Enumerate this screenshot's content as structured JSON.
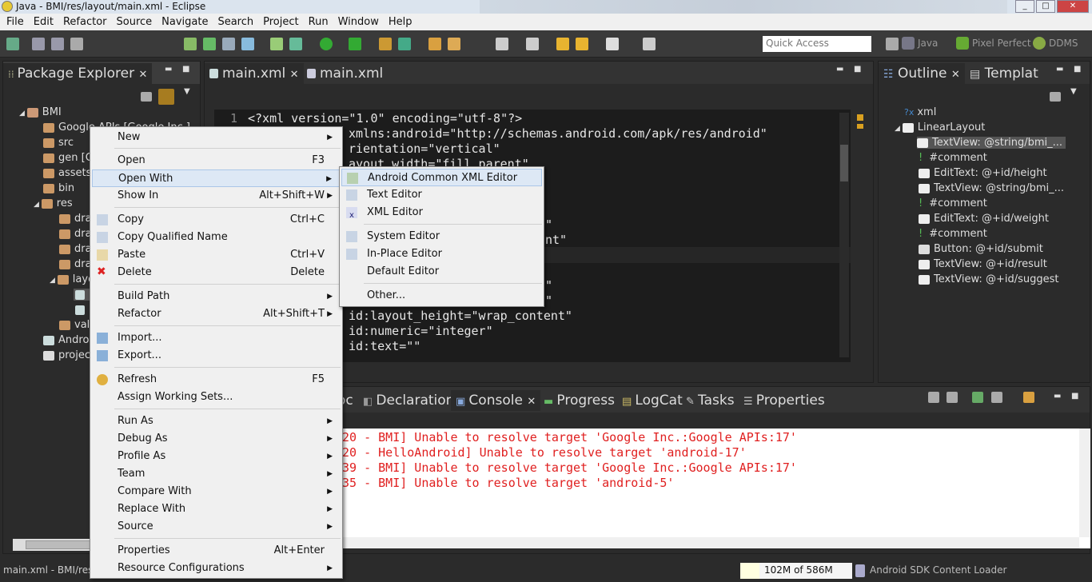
{
  "window": {
    "title": "Java - BMI/res/layout/main.xml - Eclipse",
    "min": "_",
    "max": "□",
    "close": "✕"
  },
  "menubar": [
    "File",
    "Edit",
    "Refactor",
    "Source",
    "Navigate",
    "Search",
    "Project",
    "Run",
    "Window",
    "Help"
  ],
  "toolbar": {
    "quick_access": "Quick Access",
    "perspectives": [
      "Java",
      "Pixel Perfect",
      "DDMS"
    ]
  },
  "package_explorer": {
    "tab": "Package Explorer",
    "close": "✕",
    "project": "BMI",
    "items": [
      "Google APIs [Google Inc.]",
      "src",
      "gen [G",
      "assets",
      "bin",
      "res",
      "dra",
      "dra",
      "dra",
      "dra",
      "layo",
      "",
      "",
      "valu",
      "Androi",
      "project"
    ]
  },
  "editor": {
    "tabs": [
      {
        "label": "main.xml",
        "close": "✕"
      },
      {
        "label": "main.xml"
      }
    ],
    "line_no": "1",
    "lines": [
      "<?xml version=\"1.0\" encoding=\"utf-8\"?>",
      "xmlns:android=\"http://schemas.android.com/apk/res/android\"",
      "rientation=\"vertical\"",
      "ayout_width=\"fill_parent\"",
      "\"",
      "nt\"",
      "\"",
      "\"",
      "id:layout_height=\"wrap_content\"",
      "id:numeric=\"integer\"",
      "id:text=\"\""
    ]
  },
  "outline": {
    "tabs": [
      "Outline",
      "Templat"
    ],
    "close": "✕",
    "items": [
      "xml",
      "LinearLayout",
      "TextView: @string/bmi_...",
      "#comment",
      "EditText: @+id/height",
      "TextView: @string/bmi_...",
      "#comment",
      "EditText: @+id/weight",
      "#comment",
      "Button: @+id/submit",
      "TextView: @+id/result",
      "TextView: @+id/suggest"
    ]
  },
  "bottom_tabs": [
    "oc",
    "Declaration",
    "Console",
    "Progress",
    "LogCat",
    "Tasks",
    "Properties"
  ],
  "console_close": "✕",
  "console_lines": [
    "20 - BMI] Unable to resolve target 'Google Inc.:Google APIs:17'",
    "20 - HelloAndroid] Unable to resolve target 'android-17'",
    "39 - BMI] Unable to resolve target 'Google Inc.:Google APIs:17'",
    "35 - BMI] Unable to resolve target 'android-5'"
  ],
  "context_menu": [
    {
      "label": "New",
      "sc": "",
      "sub": true
    },
    {
      "label": "Open",
      "sc": "F3"
    },
    {
      "label": "Open With",
      "sc": "",
      "sub": true
    },
    {
      "label": "Show In",
      "sc": "Alt+Shift+W",
      "sub": true
    },
    {
      "label": "Copy",
      "sc": "Ctrl+C"
    },
    {
      "label": "Copy Qualified Name",
      "sc": ""
    },
    {
      "label": "Paste",
      "sc": "Ctrl+V"
    },
    {
      "label": "Delete",
      "sc": "Delete"
    },
    {
      "label": "Build Path",
      "sc": "",
      "sub": true
    },
    {
      "label": "Refactor",
      "sc": "Alt+Shift+T",
      "sub": true
    },
    {
      "label": "Import...",
      "sc": ""
    },
    {
      "label": "Export...",
      "sc": ""
    },
    {
      "label": "Refresh",
      "sc": "F5"
    },
    {
      "label": "Assign Working Sets...",
      "sc": ""
    },
    {
      "label": "Run As",
      "sc": "",
      "sub": true
    },
    {
      "label": "Debug As",
      "sc": "",
      "sub": true
    },
    {
      "label": "Profile As",
      "sc": "",
      "sub": true
    },
    {
      "label": "Team",
      "sc": "",
      "sub": true
    },
    {
      "label": "Compare With",
      "sc": "",
      "sub": true
    },
    {
      "label": "Replace With",
      "sc": "",
      "sub": true
    },
    {
      "label": "Source",
      "sc": "",
      "sub": true
    },
    {
      "label": "Properties",
      "sc": "Alt+Enter"
    },
    {
      "label": "Resource Configurations",
      "sc": "",
      "sub": true
    }
  ],
  "submenu": [
    "Android Common XML Editor",
    "Text Editor",
    "XML Editor",
    "System Editor",
    "In-Place Editor",
    "Default Editor",
    "Other..."
  ],
  "status": {
    "left": "main.xml - BMI/res/",
    "heap": "102M of 586M",
    "loader": "Android SDK Content Loader"
  }
}
